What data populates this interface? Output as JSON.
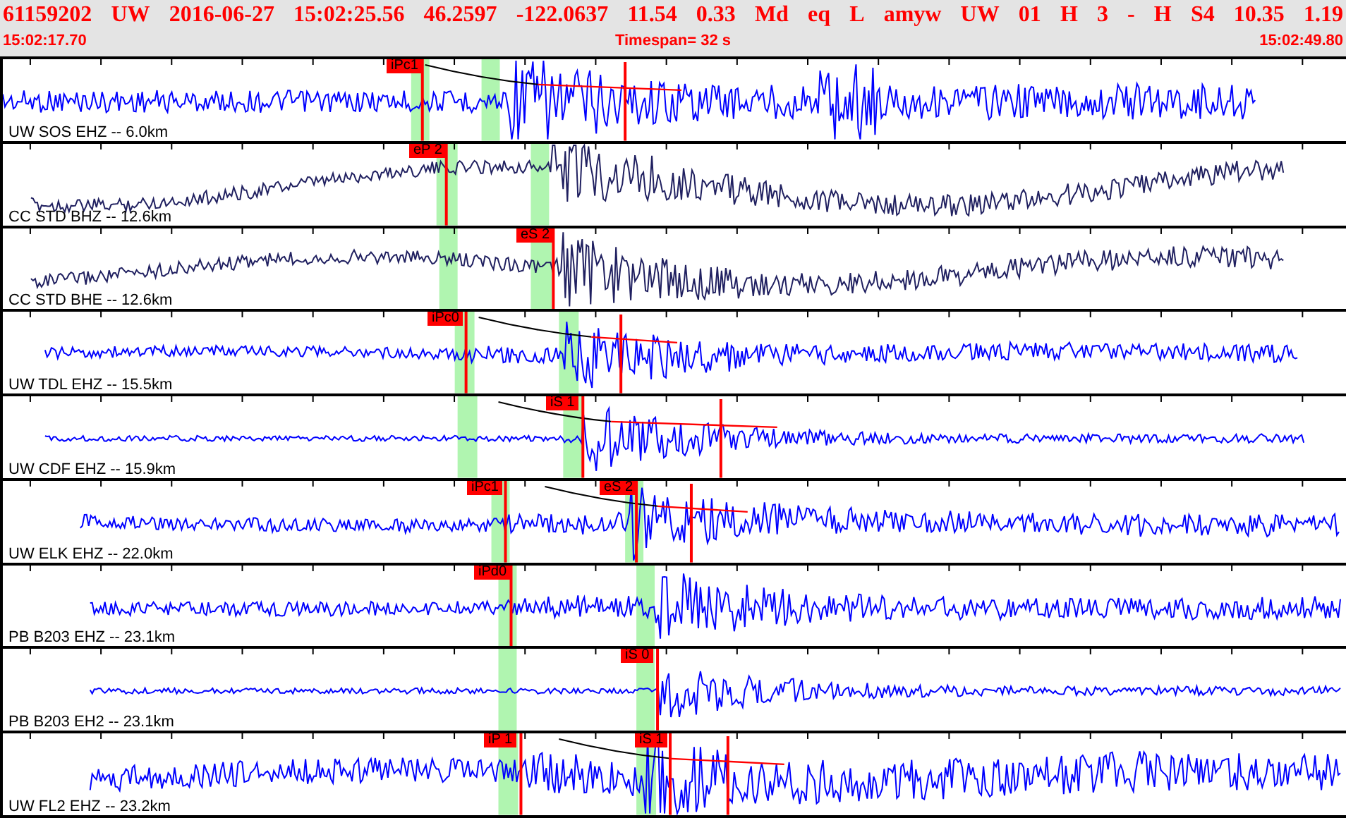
{
  "header": {
    "event": [
      "61159202",
      "UW",
      "2016-06-27",
      "15:02:25.56",
      "46.2597",
      "-122.0637",
      "11.54",
      "0.33",
      "Md",
      "eq",
      "L",
      "amyw",
      "UW",
      "01",
      "H",
      "3",
      "-",
      "H",
      "S4",
      "10.35",
      "1.19"
    ],
    "start_time": "15:02:17.70",
    "timespan": "Timespan=  32 s",
    "end_time": "15:02:49.80"
  },
  "traces": [
    {
      "label": "UW SOS EHZ -- 6.0km",
      "color": "#0000ff",
      "picks": [
        {
          "label": "iPc1"
        }
      ]
    },
    {
      "label": "CC STD BHZ -- 12.6km",
      "color": "#202060",
      "picks": [
        {
          "label": "eP 2"
        }
      ]
    },
    {
      "label": "CC STD BHE -- 12.6km",
      "color": "#202060",
      "picks": [
        {
          "label": "eS 2"
        }
      ]
    },
    {
      "label": "UW TDL EHZ -- 15.5km",
      "color": "#0000ff",
      "picks": [
        {
          "label": "iPc0"
        }
      ]
    },
    {
      "label": "UW CDF EHZ -- 15.9km",
      "color": "#0000ff",
      "picks": [
        {
          "label": "iS 1"
        }
      ]
    },
    {
      "label": "UW ELK EHZ -- 22.0km",
      "color": "#0000ff",
      "picks": [
        {
          "label": "iPc1"
        },
        {
          "label": "eS 2"
        }
      ]
    },
    {
      "label": "PB B203 EHZ -- 23.1km",
      "color": "#0000ff",
      "picks": [
        {
          "label": "iPd0"
        }
      ]
    },
    {
      "label": "PB B203 EH2 -- 23.1km",
      "color": "#0000ff",
      "picks": [
        {
          "label": "iS 0"
        }
      ]
    },
    {
      "label": "UW FL2 EHZ -- 23.2km",
      "color": "#0000ff",
      "picks": [
        {
          "label": "iP 1"
        },
        {
          "label": "iS 1"
        }
      ]
    }
  ]
}
